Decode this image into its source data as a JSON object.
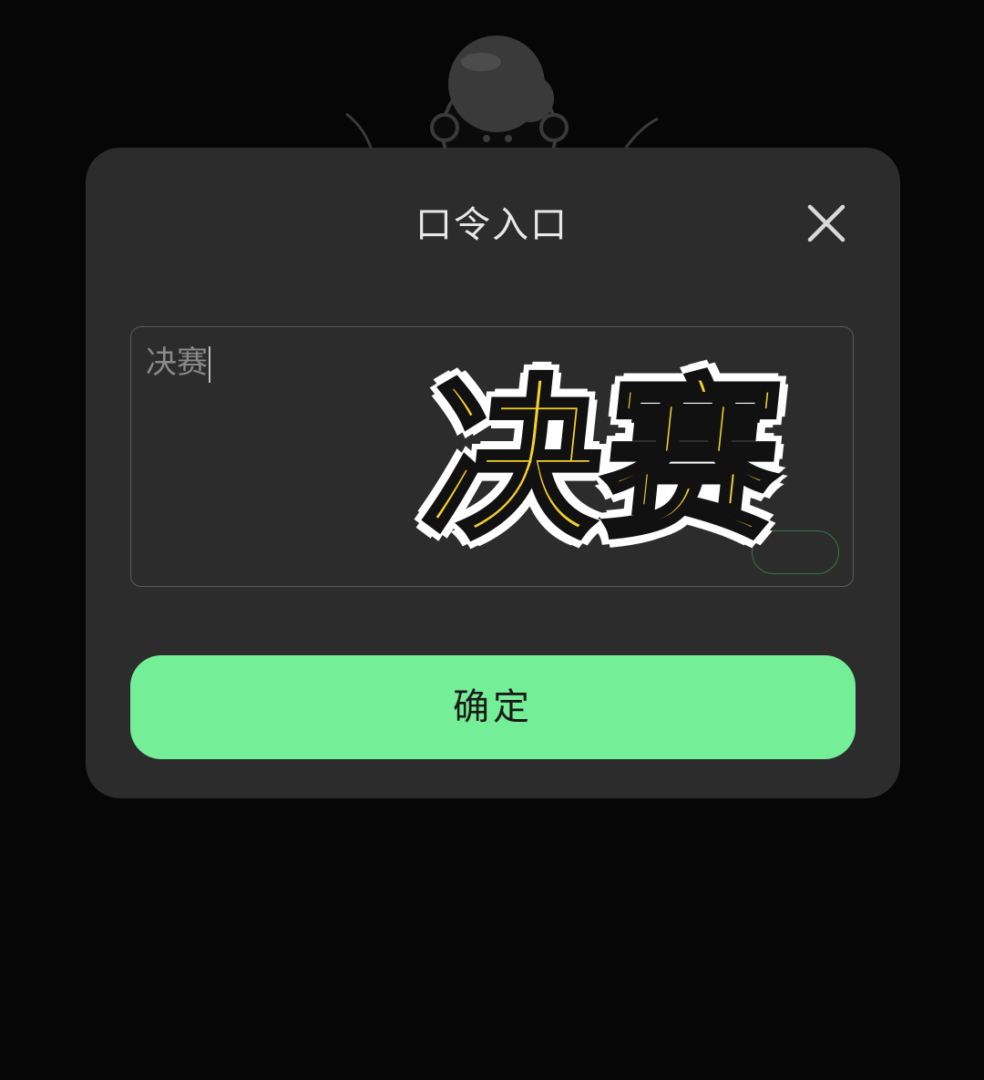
{
  "dialog": {
    "title": "口令入口",
    "close_icon": "close-icon",
    "input": {
      "value": "决赛"
    },
    "confirm_label": "确定"
  },
  "overlay": {
    "sticker_text": "决赛"
  },
  "colors": {
    "background": "#060606",
    "dialog_bg": "#2c2c2c",
    "confirm_bg": "#75ee98",
    "sticker_fill": "#f6d22a"
  }
}
